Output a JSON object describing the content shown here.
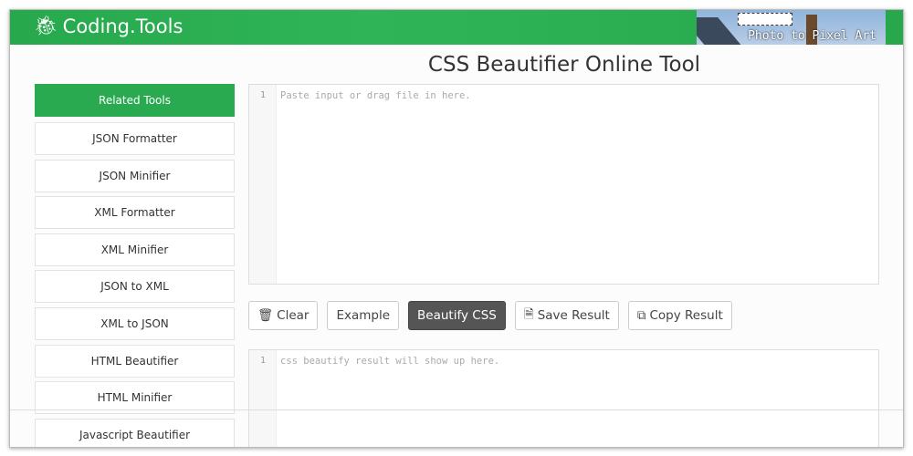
{
  "header": {
    "logo": "Coding.Tools",
    "banner_text": "Photo to Pixel Art"
  },
  "title": "CSS Beautifier Online Tool",
  "sidebar": {
    "items": [
      {
        "label": "Related Tools"
      },
      {
        "label": "JSON Formatter"
      },
      {
        "label": "JSON Minifier"
      },
      {
        "label": "XML Formatter"
      },
      {
        "label": "XML Minifier"
      },
      {
        "label": "JSON to XML"
      },
      {
        "label": "XML to JSON"
      },
      {
        "label": "HTML Beautifier"
      },
      {
        "label": "HTML Minifier"
      },
      {
        "label": "Javascript Beautifier"
      }
    ]
  },
  "input": {
    "line": "1",
    "placeholder": "Paste input or drag file in here."
  },
  "buttons": {
    "clear": "Clear",
    "example": "Example",
    "beautify": "Beautify CSS",
    "save": "Save Result",
    "copy": "Copy Result"
  },
  "output": {
    "line": "1",
    "placeholder": "css beautify result will show up here."
  }
}
